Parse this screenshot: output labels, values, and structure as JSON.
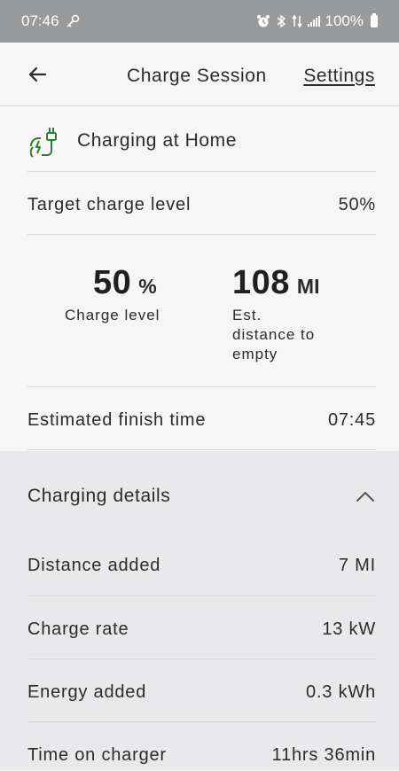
{
  "status_bar": {
    "time": "07:46",
    "battery": "100%",
    "icons": [
      "key-icon",
      "alarm-icon",
      "bluetooth-icon",
      "data-icon",
      "signal-icon",
      "battery-icon"
    ]
  },
  "app_bar": {
    "title": "Charge Session",
    "settings_label": "Settings",
    "back_icon": "arrow-left-icon"
  },
  "session": {
    "location": "Charging at Home",
    "location_icon": "charging-plug-icon",
    "target_label": "Target charge level",
    "target_value": "50%",
    "charge_level_value": "50",
    "charge_level_unit": "%",
    "charge_level_label": "Charge level",
    "distance_value": "108",
    "distance_unit": "MI",
    "distance_label_1": "Est.",
    "distance_label_2": "distance to",
    "distance_label_3": "empty",
    "finish_label": "Estimated finish time",
    "finish_value": "07:45"
  },
  "details": {
    "title": "Charging details",
    "rows": [
      {
        "label": "Distance added",
        "value": "7 MI"
      },
      {
        "label": "Charge rate",
        "value": "13 kW"
      },
      {
        "label": "Energy added",
        "value": "0.3 kWh"
      },
      {
        "label": "Time on charger",
        "value": "11hrs 36min"
      }
    ]
  },
  "colors": {
    "status_bar": "#999a9c",
    "background": "#f6f6f6",
    "panel": "#e9e9eb",
    "accent_green": "#2e7d32",
    "text": "#2b2b2b",
    "divider": "#d7d7d7"
  }
}
